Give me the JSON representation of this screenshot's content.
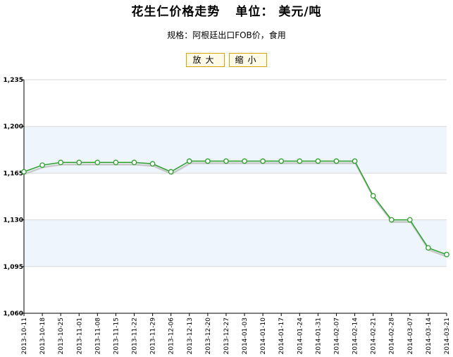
{
  "header": {
    "title": "花生仁价格走势",
    "unit": "单位：  美元/吨",
    "subtitle": "规格：阿根廷出口FOB价，食用"
  },
  "controls": {
    "zoom_in": "放大",
    "zoom_out": "缩小"
  },
  "colors": {
    "line": "#2ca02c",
    "band": "#eef5fd",
    "grid": "#d9d9d9"
  },
  "chart_data": {
    "type": "line",
    "title": "花生仁价格走势",
    "xlabel": "",
    "ylabel": "",
    "ylim": [
      1060,
      1235
    ],
    "yticks": [
      "1,235",
      "1,200",
      "1,165",
      "1,130",
      "1,095",
      "1,060"
    ],
    "yticks_values": [
      1235,
      1200,
      1165,
      1130,
      1095,
      1060
    ],
    "grid": true,
    "categories": [
      "2013-10-11",
      "2013-10-18",
      "2013-10-25",
      "2013-11-01",
      "2013-11-08",
      "2013-11-15",
      "2013-11-22",
      "2013-11-29",
      "2013-12-06",
      "2013-12-13",
      "2013-12-20",
      "2013-12-27",
      "2014-01-03",
      "2014-01-10",
      "2014-01-17",
      "2014-01-24",
      "2014-01-31",
      "2014-02-07",
      "2014-02-14",
      "2014-02-21",
      "2014-02-28",
      "2014-03-07",
      "2014-03-14",
      "2014-03-21"
    ],
    "values": [
      1166,
      1171,
      1173,
      1173,
      1173,
      1173,
      1173,
      1172,
      1166,
      1174,
      1174,
      1174,
      1174,
      1174,
      1174,
      1174,
      1174,
      1174,
      1174,
      1148,
      1130,
      1130,
      1109,
      1104
    ]
  }
}
